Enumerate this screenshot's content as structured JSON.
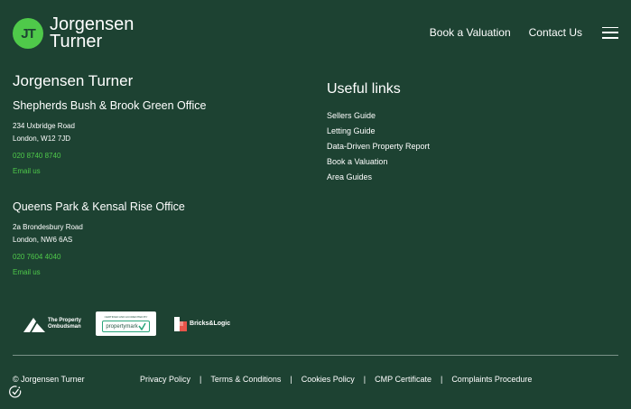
{
  "header": {
    "brand_line1": "Jorgensen",
    "brand_line2": "Turner",
    "logo_mark": "JT",
    "nav": {
      "valuation": "Book a Valuation",
      "contact": "Contact Us"
    }
  },
  "footer": {
    "brand_title": "Jorgensen Turner",
    "offices": [
      {
        "name": "Shepherds Bush & Brook Green Office",
        "address_line1": "234 Uxbridge Road",
        "address_line2": "London, W12 7JD",
        "phone": "020 8740 8740",
        "email_label": "Email us"
      },
      {
        "name": "Queens Park & Kensal Rise Office",
        "address_line1": "2a Brondesbury Road",
        "address_line2": "London, NW6 6AS",
        "phone": "020 7604 4040",
        "email_label": "Email us"
      }
    ],
    "useful_links": {
      "title": "Useful links",
      "items": [
        "Sellers Guide",
        "Letting Guide",
        "Data-Driven Property Report",
        "Book a Valuation",
        "Area Guides"
      ]
    },
    "badges": {
      "tpo_line1": "The Property",
      "tpo_line2": "Ombudsman",
      "pm_top": "CERTIFIED AND ACCREDITED BY",
      "pm_name": "propertymark",
      "bricks": "Bricks&Logic"
    },
    "copyright": "© Jorgensen Turner",
    "legal": {
      "privacy": "Privacy Policy",
      "terms": "Terms & Conditions",
      "cookies": "Cookies Policy",
      "cmp": "CMP Certificate",
      "complaints": "Complaints Procedure",
      "separator": "|"
    }
  },
  "colors": {
    "background": "#1d4232",
    "accent": "#4fc94a"
  },
  "icons": {
    "menu": "hamburger-menu-icon",
    "consent": "cookie-consent-icon"
  }
}
